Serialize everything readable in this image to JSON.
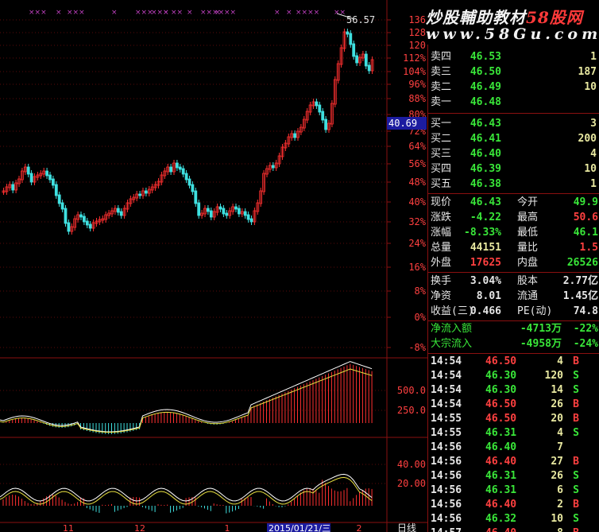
{
  "watermark": {
    "line1_cn": "炒股輔助教材",
    "line1_brand": "58股网",
    "line2": "www.58Gu.com"
  },
  "main_chart": {
    "price_axis_labels": [
      "136",
      "128",
      "120",
      "112%",
      "104%",
      "96%",
      "88%",
      "80%",
      "72%",
      "64%",
      "56%",
      "48%",
      "40%",
      "32%",
      "24%",
      "16%",
      "8%",
      "0%",
      "-8%"
    ],
    "current_price_box": "40.69",
    "peak_label": "56.57",
    "top_markers": [
      "×××",
      "×",
      "×××",
      "×",
      "×××",
      "×××",
      "×",
      "××",
      "×",
      "××××",
      "×",
      "××",
      "×",
      "×",
      "××××"
    ]
  },
  "macd_chart": {
    "axis_labels": [
      "500.0",
      "250.0"
    ]
  },
  "kdj_chart": {
    "axis_labels": [
      "40.00",
      "20.00"
    ]
  },
  "x_axis": {
    "labels": [
      "11",
      "12",
      "1",
      "2015/01/21/三",
      "2"
    ],
    "period": "日线"
  },
  "order_book": {
    "asks": [
      {
        "label": "卖四",
        "price": "46.53",
        "vol": "1"
      },
      {
        "label": "卖三",
        "price": "46.50",
        "vol": "187"
      },
      {
        "label": "卖二",
        "price": "46.49",
        "vol": "10"
      },
      {
        "label": "卖一",
        "price": "46.48",
        "vol": ""
      }
    ],
    "bids": [
      {
        "label": "买一",
        "price": "46.43",
        "vol": "3"
      },
      {
        "label": "买二",
        "price": "46.41",
        "vol": "200"
      },
      {
        "label": "买三",
        "price": "46.40",
        "vol": "4"
      },
      {
        "label": "买四",
        "price": "46.39",
        "vol": "10"
      },
      {
        "label": "买五",
        "price": "46.38",
        "vol": "1"
      }
    ]
  },
  "quote": {
    "rows": [
      {
        "l1": "现价",
        "v1": "46.43",
        "c1": "green",
        "l2": "今开",
        "v2": "49.9",
        "c2": "green"
      },
      {
        "l1": "涨跌",
        "v1": "-4.22",
        "c1": "green",
        "l2": "最高",
        "v2": "50.6",
        "c2": "red"
      },
      {
        "l1": "涨幅",
        "v1": "-8.33%",
        "c1": "green",
        "l2": "最低",
        "v2": "46.1",
        "c2": "green"
      },
      {
        "l1": "总量",
        "v1": "44151",
        "c1": "yellow",
        "l2": "量比",
        "v2": "1.5",
        "c2": "red"
      },
      {
        "l1": "外盘",
        "v1": "17625",
        "c1": "red",
        "l2": "内盘",
        "v2": "26526",
        "c2": "green"
      }
    ],
    "stats": [
      {
        "l1": "换手",
        "v1": "3.04%",
        "l2": "股本",
        "v2": "2.77亿"
      },
      {
        "l1": "净资",
        "v1": "8.01",
        "l2": "流通",
        "v2": "1.45亿"
      },
      {
        "l1": "收益(三)",
        "v1": "0.466",
        "l2": "PE(动)",
        "v2": "74.8"
      }
    ],
    "flows": [
      {
        "label": "净流入额",
        "value": "-4713万",
        "pct": "-22%"
      },
      {
        "label": "大宗流入",
        "value": "-4958万",
        "pct": "-24%"
      }
    ]
  },
  "ticks": [
    {
      "time": "14:54",
      "price": "46.50",
      "vol": "4",
      "dir": "B",
      "c": "red"
    },
    {
      "time": "14:54",
      "price": "46.30",
      "vol": "120",
      "dir": "S",
      "c": "green"
    },
    {
      "time": "14:54",
      "price": "46.30",
      "vol": "14",
      "dir": "S",
      "c": "green"
    },
    {
      "time": "14:54",
      "price": "46.50",
      "vol": "26",
      "dir": "B",
      "c": "red"
    },
    {
      "time": "14:55",
      "price": "46.50",
      "vol": "20",
      "dir": "B",
      "c": "red"
    },
    {
      "time": "14:55",
      "price": "46.31",
      "vol": "4",
      "dir": "S",
      "c": "green"
    },
    {
      "time": "14:56",
      "price": "46.40",
      "vol": "7",
      "dir": "",
      "c": "green"
    },
    {
      "time": "14:56",
      "price": "46.40",
      "vol": "27",
      "dir": "B",
      "c": "red"
    },
    {
      "time": "14:56",
      "price": "46.31",
      "vol": "26",
      "dir": "S",
      "c": "green"
    },
    {
      "time": "14:56",
      "price": "46.31",
      "vol": "6",
      "dir": "S",
      "c": "green"
    },
    {
      "time": "14:56",
      "price": "46.40",
      "vol": "2",
      "dir": "B",
      "c": "red"
    },
    {
      "time": "14:56",
      "price": "46.32",
      "vol": "10",
      "dir": "S",
      "c": "green"
    },
    {
      "time": "14:57",
      "price": "46.40",
      "vol": "8",
      "dir": "B",
      "c": "red"
    }
  ],
  "colors": {
    "up": "#ff3030",
    "down": "#3fe0e0",
    "axis": "#8a1010",
    "bid_ask_green": "#39e639",
    "marker": "#c040c0"
  }
}
